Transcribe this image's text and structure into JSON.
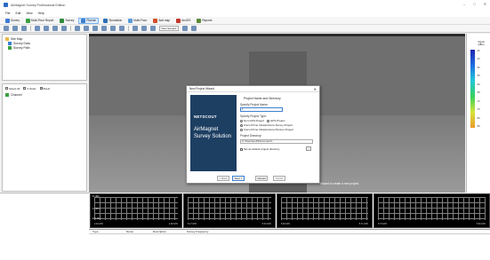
{
  "window": {
    "title": "AirMagnet Survey Professional Edition",
    "min": "–",
    "max": "□",
    "close": "✕"
  },
  "menu": [
    "File",
    "Edit",
    "View",
    "Help"
  ],
  "toolbar": [
    {
      "label": "Survey",
      "color": "#3b7bd6"
    },
    {
      "label": "Multi-Floor Report",
      "color": "#3aa040"
    },
    {
      "label": "Survey",
      "color": "#2f8a3c"
    },
    {
      "label": "Planner",
      "color": "#3c7fd0",
      "active": true
    },
    {
      "label": "Simulation",
      "color": "#2f6fb6"
    },
    {
      "label": "Multi-Floor",
      "color": "#5b9bd6"
    },
    {
      "label": "Add map",
      "color": "#d0502a"
    },
    {
      "label": "ArcGIS",
      "color": "#c0392b"
    },
    {
      "label": "Reports",
      "color": "#5a8a3a"
    }
  ],
  "toolbar2": {
    "combo": "View Sample"
  },
  "project_tree": {
    "items": [
      {
        "label": "Site Map",
        "icon": "folder-icon"
      },
      {
        "label": "Survey Data",
        "icon": "survey-data-icon"
      },
      {
        "label": "Survey Path",
        "icon": "path-icon"
      }
    ]
  },
  "channel_panel": {
    "filters": [
      "Select All",
      "2.4GHz",
      "5GHz"
    ],
    "items": [
      "Channel"
    ]
  },
  "legend": {
    "title": "Signal (dBm)",
    "ticks": [
      "-30",
      "-40",
      "-50",
      "-55",
      "-60",
      "-65",
      "-70",
      "-75",
      "-80",
      "-85"
    ]
  },
  "dialog": {
    "title": "New Project Wizard",
    "close": "✕",
    "brand_logo": "NETSCOUT",
    "brand_line1": "AirMagnet",
    "brand_line2": "Survey Solution",
    "heading": "Project Name and Directory",
    "name_label": "Specify Project Name:",
    "name_value": "1",
    "type_label": "Specify Project Type:",
    "types": [
      {
        "label": "Non-GPS Project",
        "checked": true
      },
      {
        "label": "GPS Project",
        "checked": false
      },
      {
        "label": "Cisco Prime Infrastructure Survey Project",
        "checked": false
      },
      {
        "label": "Cisco Prime Infrastructure Planner Project",
        "checked": false
      }
    ],
    "dir_label": "Project Directory:",
    "dir_value": "C:\\Users\\pub\\Documents\\",
    "browse": "...",
    "default_label": "Set as default project directory",
    "buttons": {
      "back": "< Back",
      "next": "Next >",
      "cancel": "Cancel",
      "finish": "Finish"
    }
  },
  "status_message": "Wizard to create a new project.",
  "scopes": [
    {
      "y_top": "-30 dBm",
      "y_mid": "-70 dBm",
      "y_bot": "-100 dBm",
      "x_left": "2.40 GHz",
      "x_right": "2.48 GHz"
    },
    {
      "x_left": "5.17 GHz",
      "x_right": "5.33 GHz"
    },
    {
      "x_left": "5.49 GHz",
      "x_right": "5.71 GHz"
    },
    {
      "x_left": "5.73 GHz",
      "x_right": "5.84 GHz"
    }
  ],
  "bottom_columns": [
    "Type",
    "Name",
    "Description",
    "Survey Frequency"
  ]
}
